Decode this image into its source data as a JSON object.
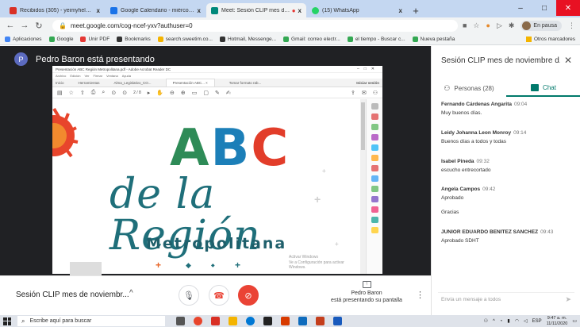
{
  "browser": {
    "tabs": [
      {
        "label": "Recibidos (305) - yeimyhelenag@gm...",
        "color": "#d93025",
        "active": false
      },
      {
        "label": "Google Calendario - miércoles, 11 de...",
        "color": "#1a73e8",
        "active": false
      },
      {
        "label": "Meet: Sesión CLIP mes de nov...",
        "color": "#00897b",
        "active": true
      },
      {
        "label": "(15) WhatsApp",
        "color": "#25d366",
        "active": false
      }
    ],
    "new_tab_label": "+",
    "close_tab_label": "x",
    "window": {
      "minimize": "–",
      "maximize": "□",
      "close": "✕"
    },
    "url": "meet.google.com/cog-ncef-yxv?authuser=0",
    "profile_status": "En pausa",
    "bookmarks": [
      {
        "label": "Aplicaciones",
        "color": "#4285f4"
      },
      {
        "label": "Google",
        "color": "#34a853"
      },
      {
        "label": "Unir PDF",
        "color": "#e53935"
      },
      {
        "label": "Bookmarks",
        "color": "#333333"
      },
      {
        "label": "search.sweetim.co...",
        "color": "#f4b400"
      },
      {
        "label": "Hotmail, Messenge...",
        "color": "#333333"
      },
      {
        "label": "Gmail: correo electr...",
        "color": "#34a853"
      },
      {
        "label": "el tiempo - Buscar c...",
        "color": "#34a853"
      },
      {
        "label": "Nueva pestaña",
        "color": "#34a853"
      }
    ],
    "other_bookmarks": "Otros marcadores"
  },
  "meet": {
    "presenter_initial": "P",
    "presenter_banner": "Pedro Baron está presentando",
    "shared_window": {
      "title": "Presentación ABC Región Metropolitana.pdf - Adobe Acrobat Reader DC",
      "menu": [
        "Archivo",
        "Edición",
        "Ver",
        "Firmar",
        "Ventana",
        "Ayuda"
      ],
      "tabs": [
        "Inicio",
        "Herramientas",
        "Alma_Legislativo_CO...",
        "Presentación ABC... ×",
        "Tomar formato rab..."
      ],
      "sign_in": "Iniciar sesión",
      "page_indicator": "2 / 8",
      "slide": {
        "abc_a": "A",
        "abc_b": "B",
        "abc_c": "C",
        "line2": "de la Región",
        "line3": "Metropolitana"
      },
      "watermark_line1": "Activar Windows",
      "watermark_line2": "Ve a Configuración para activar Windows."
    },
    "meeting_name": "Sesión CLIP mes de noviembr...",
    "chevron": "^",
    "presenting_name": "Pedro Baron",
    "presenting_status": "está presentando su pantalla",
    "panel": {
      "title": "Sesión CLIP mes de noviembre d...",
      "people_tab": "Personas (28)",
      "chat_tab": "Chat",
      "messages": [
        {
          "sender": "Fernando Cárdenas Angarita",
          "time": "09:04",
          "lines": [
            "Muy buenos días."
          ]
        },
        {
          "sender": "Leidy Johanna Leon Monroy",
          "time": "09:14",
          "lines": [
            "Buenos días a todos y todas"
          ]
        },
        {
          "sender": "Isabel Pineda",
          "time": "09:32",
          "lines": [
            "escucho entrecortado"
          ]
        },
        {
          "sender": "Angela Campos",
          "time": "09:42",
          "lines": [
            "Aprobado",
            "Gracias"
          ]
        },
        {
          "sender": "JUNIOR EDUARDO BENITEZ SANCHEZ",
          "time": "09:43",
          "lines": [
            "Aprobado SDHT"
          ]
        }
      ],
      "compose_placeholder": "Envía un mensaje a todos"
    }
  },
  "taskbar": {
    "search_placeholder": "Escribe aquí para buscar",
    "language": "ESP",
    "time": "9:47 a. m.",
    "date": "11/11/2020"
  }
}
